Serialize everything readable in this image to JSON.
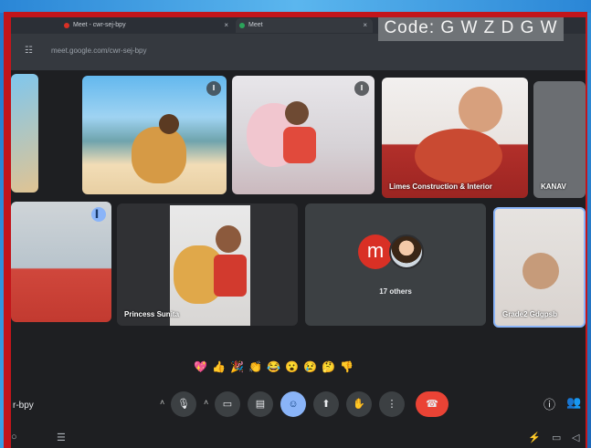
{
  "browser": {
    "tabs": [
      {
        "label": "Meet - cwr-sej-bpy",
        "close": "×"
      },
      {
        "label": "Meet",
        "close": "×"
      }
    ],
    "url": "meet.google.com/cwr-sej-bpy"
  },
  "overlay": {
    "code_text": "Code: G W Z D G W"
  },
  "tiles": [
    {
      "name": ""
    },
    {
      "name": ""
    },
    {
      "name": ""
    },
    {
      "name": "Limes Construction & Interior"
    },
    {
      "name": "KANAV"
    },
    {
      "name": ""
    },
    {
      "name": "Princess Sunita"
    },
    {
      "name": "17 others",
      "avatar_letter": "m"
    },
    {
      "name": "Grade2 Gdgpsb"
    }
  ],
  "reactions": [
    "💖",
    "👍",
    "🎉",
    "👏",
    "😂",
    "😮",
    "😢",
    "🤔",
    "👎"
  ],
  "bottom_bar": {
    "meeting_code": "r-bpy",
    "controls": [
      {
        "icon": "chevron-up-icon",
        "glyph": "˄"
      },
      {
        "icon": "mic-icon",
        "glyph": "🎙"
      },
      {
        "icon": "chevron-up-icon",
        "glyph": "˄"
      },
      {
        "icon": "camera-icon",
        "glyph": "▭"
      },
      {
        "icon": "captions-icon",
        "glyph": "▤"
      },
      {
        "icon": "emoji-icon",
        "glyph": "☺"
      },
      {
        "icon": "present-icon",
        "glyph": "⬆"
      },
      {
        "icon": "raise-hand-icon",
        "glyph": "✋"
      },
      {
        "icon": "more-options-icon",
        "glyph": "⋮"
      },
      {
        "icon": "end-call-icon",
        "glyph": "☎"
      }
    ],
    "right": [
      {
        "icon": "info-icon",
        "glyph": "ⓘ"
      },
      {
        "icon": "people-icon",
        "glyph": "👥"
      }
    ]
  },
  "colors": {
    "frame": "#c3151b",
    "end_call": "#ea4335",
    "active": "#8ab4f8",
    "avatar_m": "#d93025"
  }
}
